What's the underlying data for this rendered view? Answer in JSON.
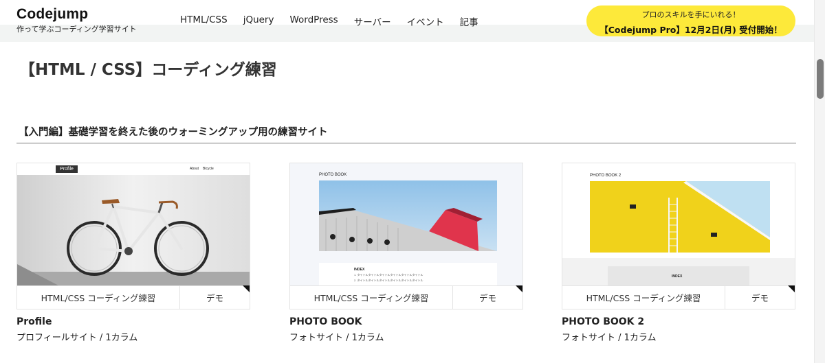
{
  "header": {
    "logo": "Codejump",
    "tagline": "作って学ぶコーディング学習サイト",
    "nav": [
      "HTML/CSS",
      "jQuery",
      "WordPress",
      "サーバー",
      "イベント",
      "記事"
    ],
    "promo": {
      "line1": "プロのスキルを手にいれる！",
      "line2": "【Codejump Pro】12月2日(月) 受付開始！",
      "color": "#fde93a"
    }
  },
  "page_title": "【HTML / CSS】コーディング練習",
  "section_title": "【入門編】基礎学習を終えた後のウォーミングアップ用の練習サイト",
  "cards": [
    {
      "name": "Profile",
      "desc": "プロフィールサイト / 1カラム",
      "practice_label": "HTML/CSS コーディング練習",
      "demo_label": "デモ",
      "thumb": {
        "brand": "Profile",
        "nav1": "About",
        "nav2": "Bicycle"
      }
    },
    {
      "name": "PHOTO BOOK",
      "desc": "フォトサイト / 1カラム",
      "practice_label": "HTML/CSS コーディング練習",
      "demo_label": "デモ",
      "thumb": {
        "title": "PHOTO BOOK",
        "index_label": "INDEX",
        "list1": "1. タイトルタイトルタイトルタイトルタイトルタイトル",
        "list2": "2. タイトルタイトルタイトルタイトルタイトルタイトル"
      }
    },
    {
      "name": "PHOTO BOOK 2",
      "desc": "フォトサイト / 1カラム",
      "practice_label": "HTML/CSS コーディング練習",
      "demo_label": "デモ",
      "thumb": {
        "title": "PHOTO BOOK 2",
        "index_label": "INDEX"
      }
    }
  ]
}
